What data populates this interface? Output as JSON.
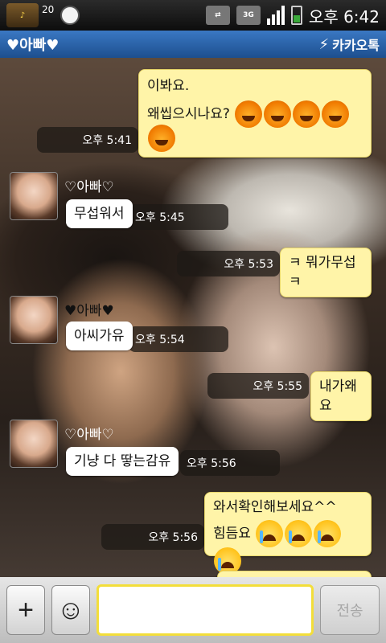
{
  "status_bar": {
    "app_badge": "감성\n음악앱",
    "notification_count": "20",
    "network": "3G",
    "time": "오후 6:42"
  },
  "title_bar": {
    "chat_title": "♥아빠♥",
    "brand": "카카오톡"
  },
  "messages": [
    {
      "type": "out",
      "text1": "이봐요.",
      "text2": "왜씹으시나요?",
      "time": "오후 5:41"
    },
    {
      "type": "in",
      "sender": "♡아빠♡",
      "text": "무섭워서",
      "time": "오후 5:45"
    },
    {
      "type": "out",
      "text": "ㅋ 뭐가무섭 ㅋ",
      "time": "오후 5:53"
    },
    {
      "type": "in",
      "sender": "♥아빠♥",
      "text": "아씨가유",
      "time": "오후 5:54"
    },
    {
      "type": "out",
      "text": "내가왜요",
      "time": "오후 5:55"
    },
    {
      "type": "in",
      "sender": "♡아빠♡",
      "text": "기냥 다 땋는감유",
      "time": "오후 5:56"
    },
    {
      "type": "out",
      "text1": "와서확인해보세요^^",
      "text2": "힘듬요",
      "time": "오후 5:56"
    }
  ],
  "input_bar": {
    "plus_label": "+",
    "emoji_label": "☺",
    "message_placeholder": "",
    "send_label": "전송"
  }
}
